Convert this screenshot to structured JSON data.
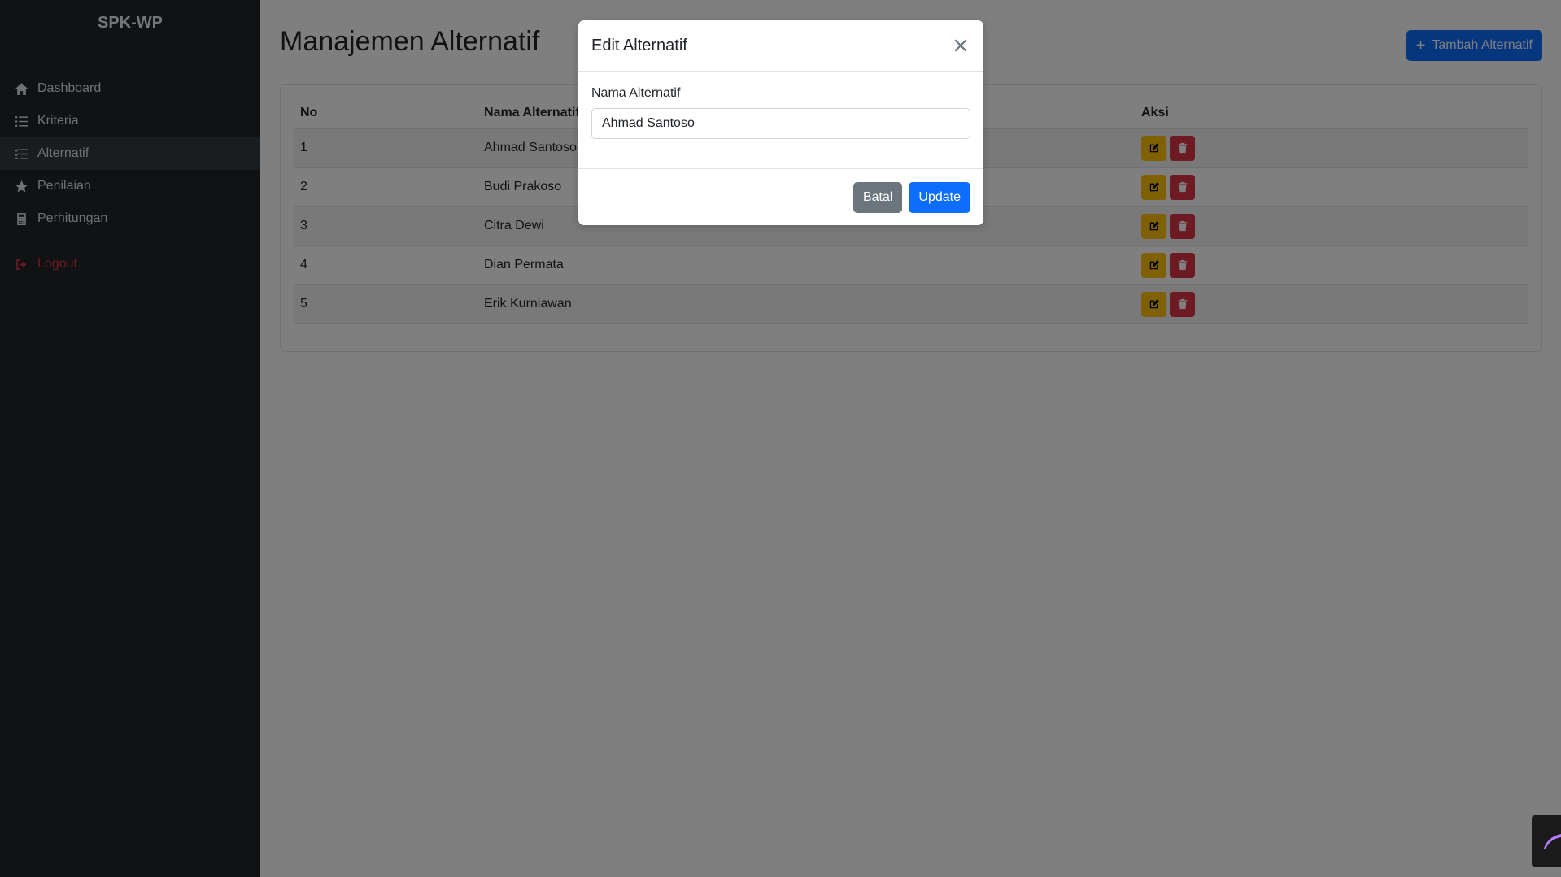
{
  "sidebar": {
    "brand": "SPK-WP",
    "items": [
      {
        "label": "Dashboard",
        "icon": "home-icon"
      },
      {
        "label": "Kriteria",
        "icon": "list-icon"
      },
      {
        "label": "Alternatif",
        "icon": "checklist-icon",
        "active": true
      },
      {
        "label": "Penilaian",
        "icon": "star-icon"
      },
      {
        "label": "Perhitungan",
        "icon": "calculator-icon"
      }
    ],
    "logout": {
      "label": "Logout",
      "icon": "sign-out-icon"
    }
  },
  "main": {
    "title": "Manajemen Alternatif",
    "add_button": {
      "label": "Tambah Alternatif",
      "icon": "plus-icon"
    },
    "table": {
      "headers": [
        "No",
        "Nama Alternatif",
        "Aksi"
      ],
      "rows": [
        {
          "no": "1",
          "name": "Ahmad Santoso"
        },
        {
          "no": "2",
          "name": "Budi Prakoso"
        },
        {
          "no": "3",
          "name": "Citra Dewi"
        },
        {
          "no": "4",
          "name": "Dian Permata"
        },
        {
          "no": "5",
          "name": "Erik Kurniawan"
        }
      ]
    }
  },
  "modal": {
    "title": "Edit Alternatif",
    "field_label": "Nama Alternatif",
    "field_value": "Ahmad Santoso",
    "cancel_label": "Batal",
    "update_label": "Update"
  },
  "colors": {
    "sidebar_bg": "#212529",
    "primary": "#0d6efd",
    "warning": "#ffc107",
    "danger": "#dc3545",
    "secondary": "#6c757d"
  }
}
